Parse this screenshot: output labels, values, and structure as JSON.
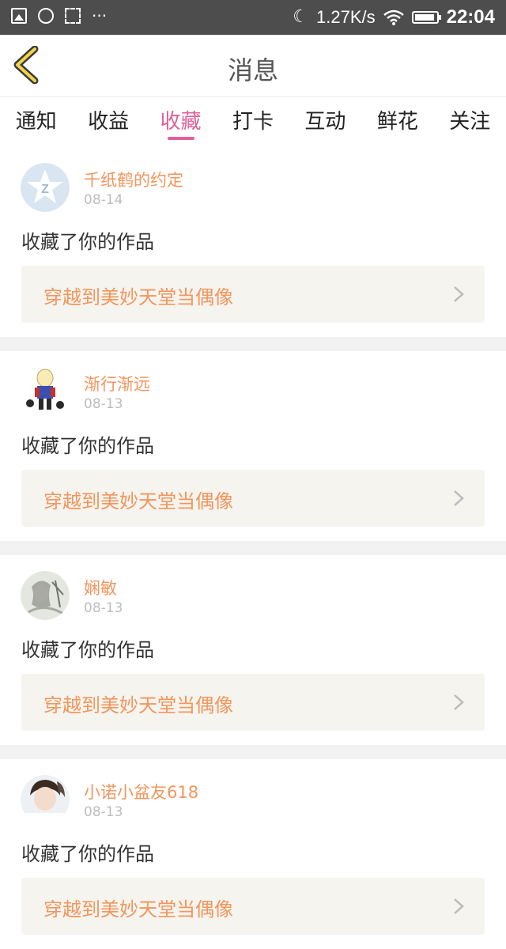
{
  "status_bar": {
    "net_speed": "1.27K/s",
    "time": "22:04",
    "icons": [
      "image-icon",
      "chat-icon",
      "screenshot-icon",
      "more-dots-icon",
      "moon-icon",
      "wifi-icon",
      "battery-icon"
    ]
  },
  "header": {
    "title": "消息"
  },
  "tabs": [
    {
      "label": "通知",
      "active": false
    },
    {
      "label": "收益",
      "active": false
    },
    {
      "label": "收藏",
      "active": true
    },
    {
      "label": "打卡",
      "active": false
    },
    {
      "label": "互动",
      "active": false
    },
    {
      "label": "鲜花",
      "active": false
    },
    {
      "label": "关注",
      "active": false
    }
  ],
  "colors": {
    "accent": "#e0609b",
    "name": "#f2965e",
    "statusbar": "#4d4d4d"
  },
  "items": [
    {
      "username": "千纸鹤的约定",
      "date": "08-14",
      "action": "收藏了你的作品",
      "work_title": "穿越到美妙天堂当偶像"
    },
    {
      "username": "渐行渐远",
      "date": "08-13",
      "action": "收藏了你的作品",
      "work_title": "穿越到美妙天堂当偶像"
    },
    {
      "username": "娴敏",
      "date": "08-13",
      "action": "收藏了你的作品",
      "work_title": "穿越到美妙天堂当偶像"
    },
    {
      "username": "小诺小盆友618",
      "date": "08-13",
      "action": "收藏了你的作品",
      "work_title": "穿越到美妙天堂当偶像"
    }
  ]
}
